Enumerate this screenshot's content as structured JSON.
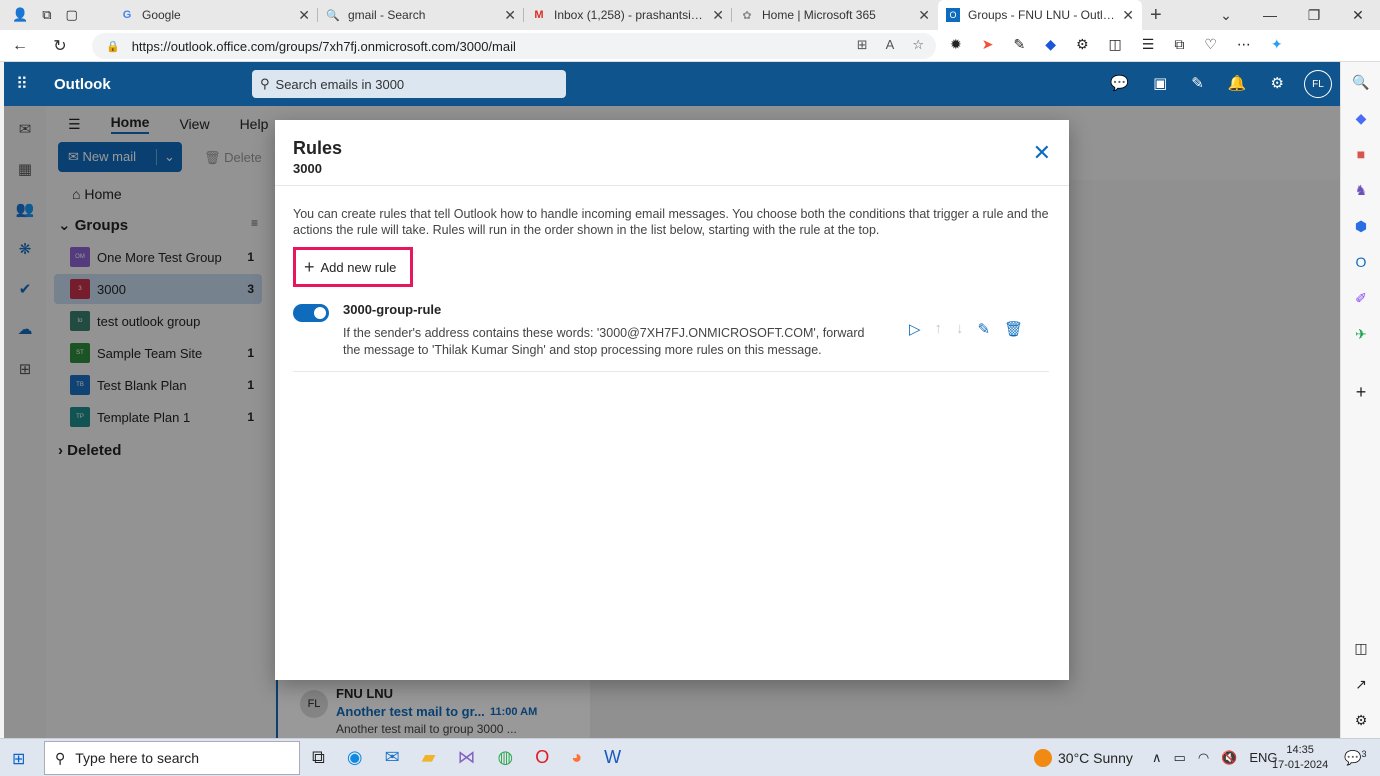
{
  "browser": {
    "tabs": [
      {
        "title": "Google",
        "icon": "google-icon"
      },
      {
        "title": "gmail - Search",
        "icon": "search-icon"
      },
      {
        "title": "Inbox (1,258) - prashantsinha2…",
        "icon": "gmail-icon"
      },
      {
        "title": "Home | Microsoft 365",
        "icon": "m365-icon"
      },
      {
        "title": "Groups - FNU LNU - Outlook",
        "icon": "outlook-icon"
      }
    ],
    "url": "https://outlook.office.com/groups/7xh7fj.onmicrosoft.com/3000/mail"
  },
  "outlook": {
    "brand": "Outlook",
    "search_placeholder": "Search emails in 3000",
    "avatar_initials": "FL",
    "ribbon_tabs": [
      "Home",
      "View",
      "Help"
    ],
    "new_mail_label": "New mail",
    "delete_label": "Delete",
    "nav_home": "Home",
    "nav_groups": "Groups",
    "nav_deleted": "Deleted",
    "groups": [
      {
        "abbr": "OM",
        "name": "One More Test Group",
        "count": "1",
        "color": "#8a63d2"
      },
      {
        "abbr": "3",
        "name": "3000",
        "count": "3",
        "color": "#c4314b"
      },
      {
        "abbr": "to",
        "name": "test outlook group",
        "count": "",
        "color": "#3a7f6f"
      },
      {
        "abbr": "ST",
        "name": "Sample Team Site",
        "count": "1",
        "color": "#2e8b3d"
      },
      {
        "abbr": "TB",
        "name": "Test Blank Plan",
        "count": "1",
        "color": "#1b6ec2"
      },
      {
        "abbr": "TP",
        "name": "Template Plan 1",
        "count": "1",
        "color": "#1f8a8a"
      }
    ],
    "message_preview": {
      "avatar": "FL",
      "from": "FNU LNU",
      "subject": "Another test mail to gr...",
      "time": "11:00 AM",
      "preview": "Another test mail to group 3000 ..."
    }
  },
  "dialog": {
    "title": "Rules",
    "subtitle": "3000",
    "description": "You can create rules that tell Outlook how to handle incoming email messages. You choose both the conditions that trigger a rule and the actions the rule will take. Rules will run in the order shown in the list below, starting with the rule at the top.",
    "add_rule_label": "Add new rule",
    "rules": [
      {
        "name": "3000-group-rule",
        "enabled": true,
        "description": "If the sender's address contains these words: '3000@7XH7FJ.ONMICROSOFT.COM', forward the message to 'Thilak Kumar Singh' and stop processing more rules on this message."
      }
    ]
  },
  "taskbar": {
    "search_placeholder": "Type here to search",
    "weather": "30°C  Sunny",
    "lang": "ENG",
    "time": "14:35",
    "date": "17-01-2024",
    "notifications": "3"
  },
  "colors": {
    "outlook_header": "#0f548c",
    "accent": "#0f6cbd",
    "highlight_box": "#e8175d"
  }
}
